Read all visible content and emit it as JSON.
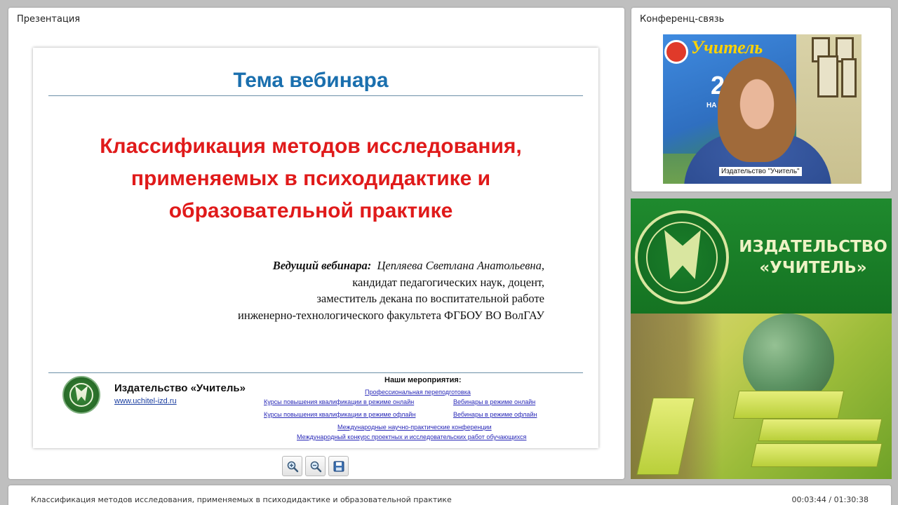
{
  "presentation_panel": {
    "title": "Презентация"
  },
  "slide": {
    "heading": "Тема вебинара",
    "title_lines": [
      "Классификация методов исследования,",
      "применяемых в психодидактике и",
      "образовательной практике"
    ],
    "presenter_label": "Ведущий вебинара",
    "presenter_name": "Цепляева Светлана Анатольевна,",
    "presenter_lines": [
      "кандидат педагогических наук,  доцент,",
      "заместитель декана по воспитательной работе",
      "инженерно-технологического факультета  ФГБОУ ВО ВолГАУ"
    ],
    "publisher_name": "Издательство «Учитель»",
    "publisher_url": "www.uchitel-izd.ru",
    "events_title": "Наши мероприятия:",
    "events": {
      "retraining": "Профессиональная переподготовка",
      "courses_online": "Курсы повышения квалификации в режиме онлайн",
      "webinars_online": "Вебинары в режиме онлайн",
      "courses_offline": "Курсы повышения квалификации в режиме офлайн",
      "webinars_offline": "Вебинары в режиме офлайн",
      "conferences": "Международные научно-практические конференции",
      "contest": "Международный конкурс проектных и исследовательских работ обучающихся"
    }
  },
  "toolbar": {
    "zoom_in_icon": "zoom-in-icon",
    "zoom_out_icon": "zoom-out-icon",
    "save_icon": "save-icon"
  },
  "conference_panel": {
    "title": "Конференц-связь",
    "video_label": "Издательство \"Учитель\"",
    "video_backdrop": {
      "logo_text": "Учитель",
      "number": "25",
      "sub": "НА КН"
    }
  },
  "banner": {
    "line1": "ИЗДАТЕЛЬСТВО",
    "line2": "«УЧИТЕЛЬ»"
  },
  "bottom_bar": {
    "title": "Классификация методов исследования, применяемых в психодидактике и образовательной практике",
    "time": "00:03:44 / 01:30:38"
  },
  "colors": {
    "heading": "#1a6fae",
    "title": "#e01a1a",
    "banner_green": "#1f8a2e"
  }
}
